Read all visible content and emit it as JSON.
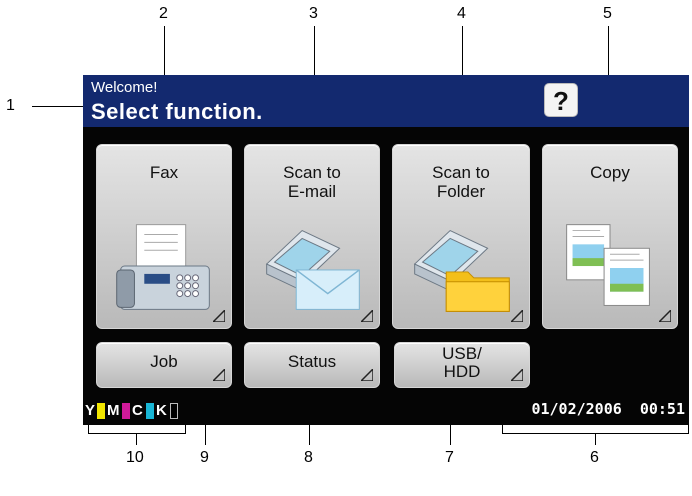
{
  "callouts": [
    "1",
    "2",
    "3",
    "4",
    "5",
    "6",
    "7",
    "8",
    "9",
    "10"
  ],
  "header": {
    "welcome": "Welcome!",
    "title": "Select function."
  },
  "help": {
    "label": "?"
  },
  "functions": [
    {
      "label": "Fax"
    },
    {
      "label": "Scan to\nE-mail"
    },
    {
      "label": "Scan to\nFolder"
    },
    {
      "label": "Copy"
    }
  ],
  "bottom_buttons": [
    {
      "label": "Job"
    },
    {
      "label": "Status"
    },
    {
      "label": "USB/\nHDD"
    }
  ],
  "toner": {
    "labels": [
      "Y",
      "M",
      "C",
      "K"
    ],
    "colors": [
      "#f2e600",
      "#d11a9a",
      "#18b6d6",
      "#000000"
    ]
  },
  "datetime": "01/02/2006  00:51",
  "colors": {
    "header": "#13296f",
    "screen": "#050505",
    "button": "#d0d0d0"
  }
}
